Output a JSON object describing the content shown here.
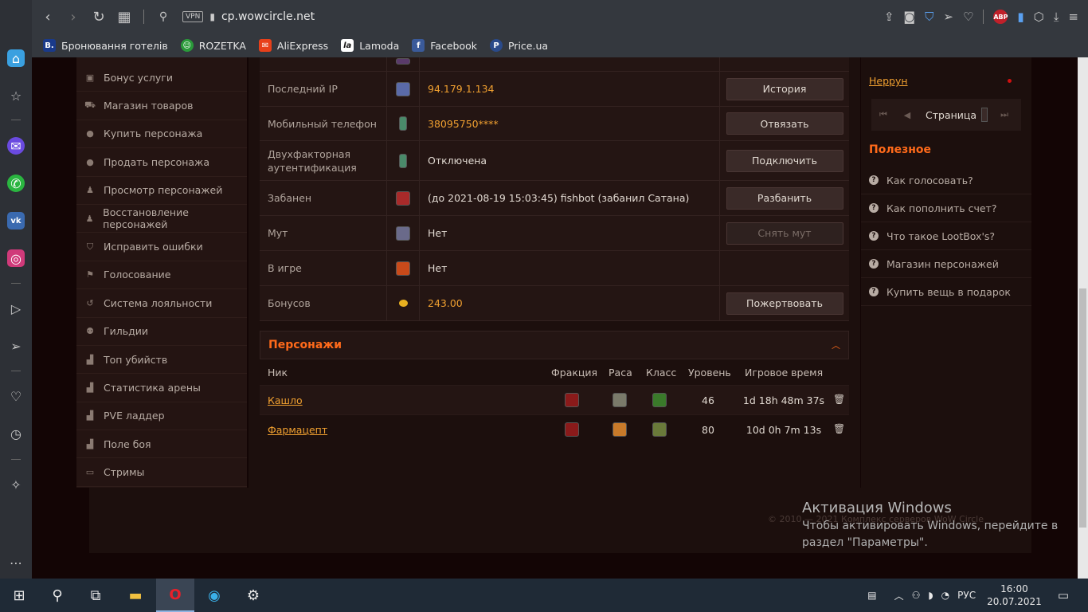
{
  "browser": {
    "url": "cp.wowcircle.net",
    "vpn_label": "VPN",
    "abp_label": "ABP",
    "bookmarks": [
      {
        "label": "Бронювання готелів",
        "icon_text": "B.",
        "color": "#1a3a8a"
      },
      {
        "label": "ROZETKA",
        "icon_text": "☺",
        "color": "#2a9a3a"
      },
      {
        "label": "AliExpress",
        "icon_text": "✉",
        "color": "#e8401a"
      },
      {
        "label": "Lamoda",
        "icon_text": "la",
        "color": "#111111"
      },
      {
        "label": "Facebook",
        "icon_text": "f",
        "color": "#3a5a9a"
      },
      {
        "label": "Price.ua",
        "icon_text": "P",
        "color": "#2a4a8a"
      }
    ]
  },
  "left_nav": [
    {
      "label": "Бонус услуги",
      "icon": "gift-icon"
    },
    {
      "label": "Магазин товаров",
      "icon": "cart-icon"
    },
    {
      "label": "Купить персонажа",
      "icon": "person-icon"
    },
    {
      "label": "Продать персонажа",
      "icon": "person-icon"
    },
    {
      "label": "Просмотр персонажей",
      "icon": "figure-icon"
    },
    {
      "label": "Восстановление персонажей",
      "icon": "figure-icon"
    },
    {
      "label": "Исправить ошибки",
      "icon": "shield-icon"
    },
    {
      "label": "Голосование",
      "icon": "flag-icon"
    },
    {
      "label": "Система лояльности",
      "icon": "refresh-icon"
    },
    {
      "label": "Гильдии",
      "icon": "group-icon"
    },
    {
      "label": "Топ убийств",
      "icon": "chart-icon"
    },
    {
      "label": "Статистика арены",
      "icon": "chart-icon"
    },
    {
      "label": "PVE ладдер",
      "icon": "chart-icon"
    },
    {
      "label": "Поле боя",
      "icon": "chart-icon"
    },
    {
      "label": "Стримы",
      "icon": "stream-icon"
    }
  ],
  "info_rows": [
    {
      "label": "Последний IP",
      "value": "94.179.1.134",
      "value_color": "orange",
      "action": "История",
      "icon_color": "#5a6aa8"
    },
    {
      "label": "Мобильный телефон",
      "value": "38095750****",
      "value_color": "orange",
      "action": "Отвязать",
      "icon_color": "#4a8a6a"
    },
    {
      "label": "Двухфакторная аутентификация",
      "value": "Отключена",
      "value_color": "white",
      "action": "Подключить",
      "icon_color": "#4a8a6a"
    },
    {
      "label": "Забанен",
      "value": "(до 2021-08-19 15:03:45) fishbot (забанил Сатана)",
      "value_color": "white",
      "action": "Разбанить",
      "icon_color": "#a82a2a"
    },
    {
      "label": "Мут",
      "value": "Нет",
      "value_color": "white",
      "action": "Снять мут",
      "action_disabled": true,
      "icon_color": "#6a6a8a"
    },
    {
      "label": "В игре",
      "value": "Нет",
      "value_color": "white",
      "action": "",
      "icon_color": "#c84a1a"
    },
    {
      "label": "Бонусов",
      "value": "243.00",
      "value_color": "orange",
      "action": "Пожертвовать",
      "icon_color": "#e8b020"
    }
  ],
  "characters": {
    "title": "Персонажи",
    "columns": {
      "nick": "Ник",
      "faction": "Фракция",
      "race": "Раса",
      "class": "Класс",
      "level": "Уровень",
      "playtime": "Игровое время"
    },
    "rows": [
      {
        "nick": "Кашло",
        "level": "46",
        "playtime": "1d 18h 48m 37s",
        "race_color": "#7a7a6a",
        "class_color": "#3a7a2a"
      },
      {
        "nick": "Фармацепт",
        "level": "80",
        "playtime": "10d 0h 7m 13s",
        "race_color": "#c87a2a",
        "class_color": "#6a7a3a"
      }
    ]
  },
  "right_panel": {
    "user": "Неррун",
    "page_label": "Страница",
    "useful_title": "Полезное",
    "useful": [
      "Как голосовать?",
      "Как пополнить счет?",
      "Что такое LootBox's?",
      "Магазин персонажей",
      "Купить вещь в подарок"
    ]
  },
  "footer": {
    "copyright": "© 2010 — 2021 Комплекс серверов WoW Circle"
  },
  "activation": {
    "title": "Активация Windows",
    "line1": "Чтобы активировать Windows, перейдите в",
    "line2": "раздел \"Параметры\"."
  },
  "taskbar": {
    "lang": "РУС",
    "time": "16:00",
    "date": "20.07.2021"
  }
}
